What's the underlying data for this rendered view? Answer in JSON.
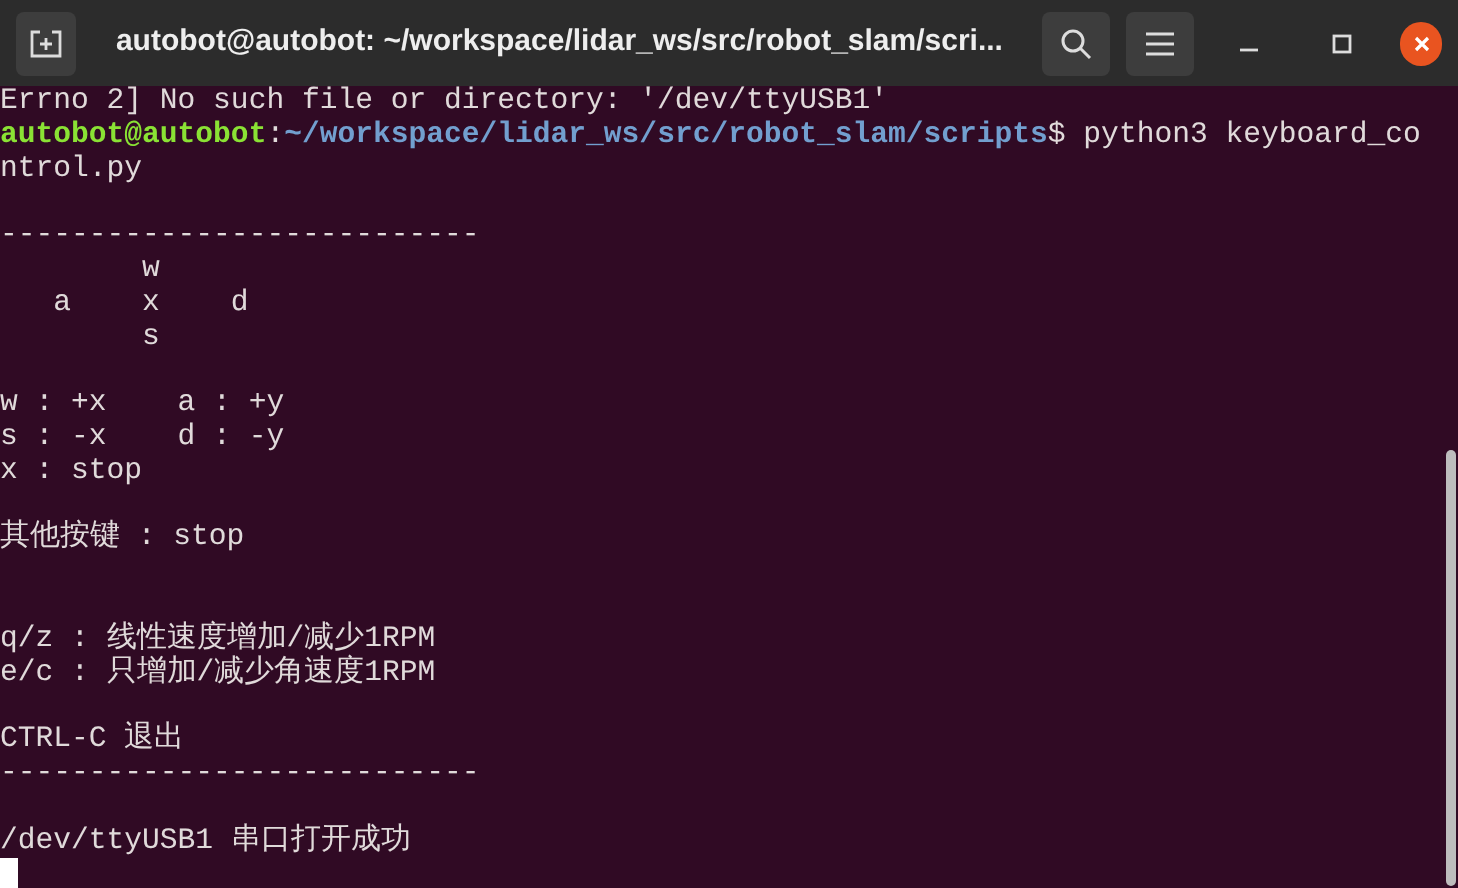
{
  "window": {
    "title": "autobot@autobot: ~/workspace/lidar_ws/src/robot_slam/scri..."
  },
  "terminal": {
    "lines": [
      {
        "kind": "text",
        "text": "Errno 2] No such file or directory: '/dev/ttyUSB1'"
      },
      {
        "kind": "prompt",
        "user": "autobot@autobot",
        "separator": ":",
        "path": "~/workspace/lidar_ws/src/robot_slam/scripts",
        "text": "$ python3 keyboard_co"
      },
      {
        "kind": "text",
        "text": "ntrol.py"
      },
      {
        "kind": "blank"
      },
      {
        "kind": "text",
        "text": "---------------------------"
      },
      {
        "kind": "text",
        "text": "        w"
      },
      {
        "kind": "text",
        "text": "   a    x    d"
      },
      {
        "kind": "text",
        "text": "        s"
      },
      {
        "kind": "blank"
      },
      {
        "kind": "text",
        "text": "w : +x    a : +y"
      },
      {
        "kind": "text",
        "text": "s : -x    d : -y"
      },
      {
        "kind": "text",
        "text": "x : stop"
      },
      {
        "kind": "blank"
      },
      {
        "kind": "text",
        "text": "其他按键 : stop"
      },
      {
        "kind": "blank"
      },
      {
        "kind": "blank"
      },
      {
        "kind": "text",
        "text": "q/z : 线性速度增加/减少1RPM"
      },
      {
        "kind": "text",
        "text": "e/c : 只增加/减少角速度1RPM"
      },
      {
        "kind": "blank"
      },
      {
        "kind": "text",
        "text": "CTRL-C 退出"
      },
      {
        "kind": "text",
        "text": "---------------------------"
      },
      {
        "kind": "blank"
      },
      {
        "kind": "text",
        "text": "/dev/ttyUSB1 串口打开成功"
      },
      {
        "kind": "cursor"
      }
    ]
  }
}
